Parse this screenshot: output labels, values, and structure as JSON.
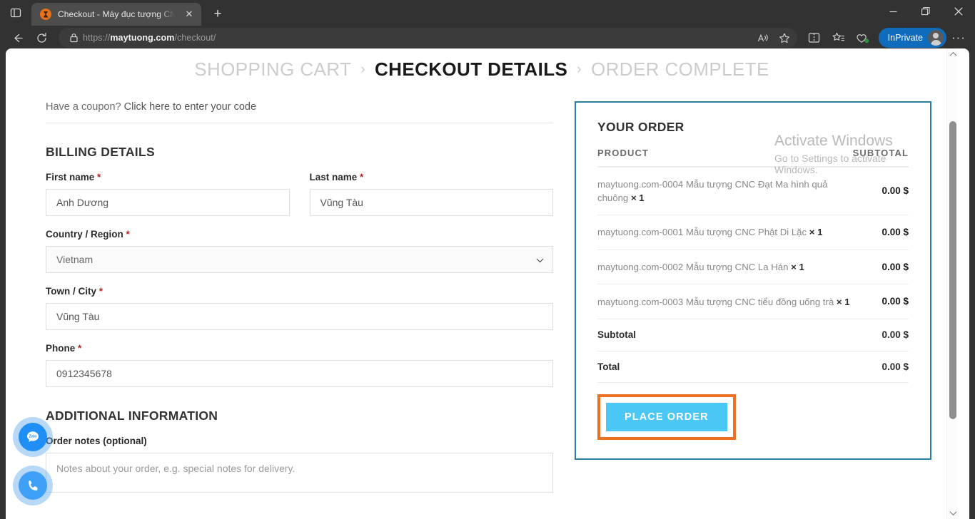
{
  "browser": {
    "tab": {
      "title": "Checkout - Máy đục tượng CNC",
      "favicon": "site-favicon",
      "close_label": "✕"
    },
    "new_tab_label": "+",
    "window_controls": {
      "minimize": "—",
      "maximize": "▢",
      "close": "✕"
    },
    "nav": {
      "back": "←",
      "reload": "⟳"
    },
    "address": {
      "lock_icon": "lock-icon",
      "scheme": "https://",
      "domain": "maytuong.com",
      "path": "/checkout/",
      "read_aloud_icon": "read-aloud-icon",
      "favorite_icon": "star-icon"
    },
    "toolbar": {
      "split_screen_icon": "split-screen-icon",
      "favorites_icon": "favorites-list-icon",
      "collections_icon": "collections-icon",
      "profile_label": "InPrivate",
      "settings_icon": "more-options-icon"
    }
  },
  "breadcrumb": {
    "steps": [
      {
        "label": "SHOPPING CART",
        "active": false
      },
      {
        "label": "CHECKOUT DETAILS",
        "active": true
      },
      {
        "label": "ORDER COMPLETE",
        "active": false
      }
    ],
    "separator": "›"
  },
  "coupon": {
    "prefix": "Have a coupon?",
    "link": "Click here to enter your code"
  },
  "billing": {
    "title": "BILLING DETAILS",
    "fields": [
      {
        "label": "First name",
        "required": "*",
        "value": "Anh Dương",
        "type": "text"
      },
      {
        "label": "Last name",
        "required": "*",
        "value": "Vũng Tàu",
        "type": "text"
      },
      {
        "label": "Country / Region",
        "required": "*",
        "value": "Vietnam",
        "type": "select"
      },
      {
        "label": "Town / City",
        "required": "*",
        "value": "Vũng Tàu",
        "type": "text"
      },
      {
        "label": "Phone",
        "required": "*",
        "value": "0912345678",
        "type": "text"
      }
    ]
  },
  "additional": {
    "title": "ADDITIONAL INFORMATION",
    "notes_label": "Order notes (optional)",
    "notes_value": "",
    "notes_placeholder": "Notes about your order, e.g. special notes for delivery."
  },
  "order": {
    "title": "YOUR ORDER",
    "col_product": "PRODUCT",
    "col_subtotal": "SUBTOTAL",
    "items": [
      {
        "name": "maytuong.com-0004 Mẫu tượng CNC Đạt Ma hình quả chuông",
        "qty": "× 1",
        "amount": "0.00 $"
      },
      {
        "name": "maytuong.com-0001 Mẫu tượng CNC Phật Di Lặc",
        "qty": "× 1",
        "amount": "0.00 $"
      },
      {
        "name": "maytuong.com-0002 Mẫu tượng CNC La Hán",
        "qty": "× 1",
        "amount": "0.00 $"
      },
      {
        "name": "maytuong.com-0003 Mẫu tượng CNC tiểu đồng uống trà",
        "qty": "× 1",
        "amount": "0.00 $"
      }
    ],
    "subtotal_label": "Subtotal",
    "subtotal_value": "0.00 $",
    "total_label": "Total",
    "total_value": "0.00 $",
    "place_order_label": "PLACE ORDER",
    "border_color": "#2a7f9e",
    "highlight_color": "#ed7120",
    "button_color": "#4bc7f5"
  },
  "watermark": {
    "line1": "Activate Windows",
    "line2": "Go to Settings to activate Windows."
  },
  "floating": {
    "zalo": "zalo-icon",
    "phone": "phone-icon"
  }
}
